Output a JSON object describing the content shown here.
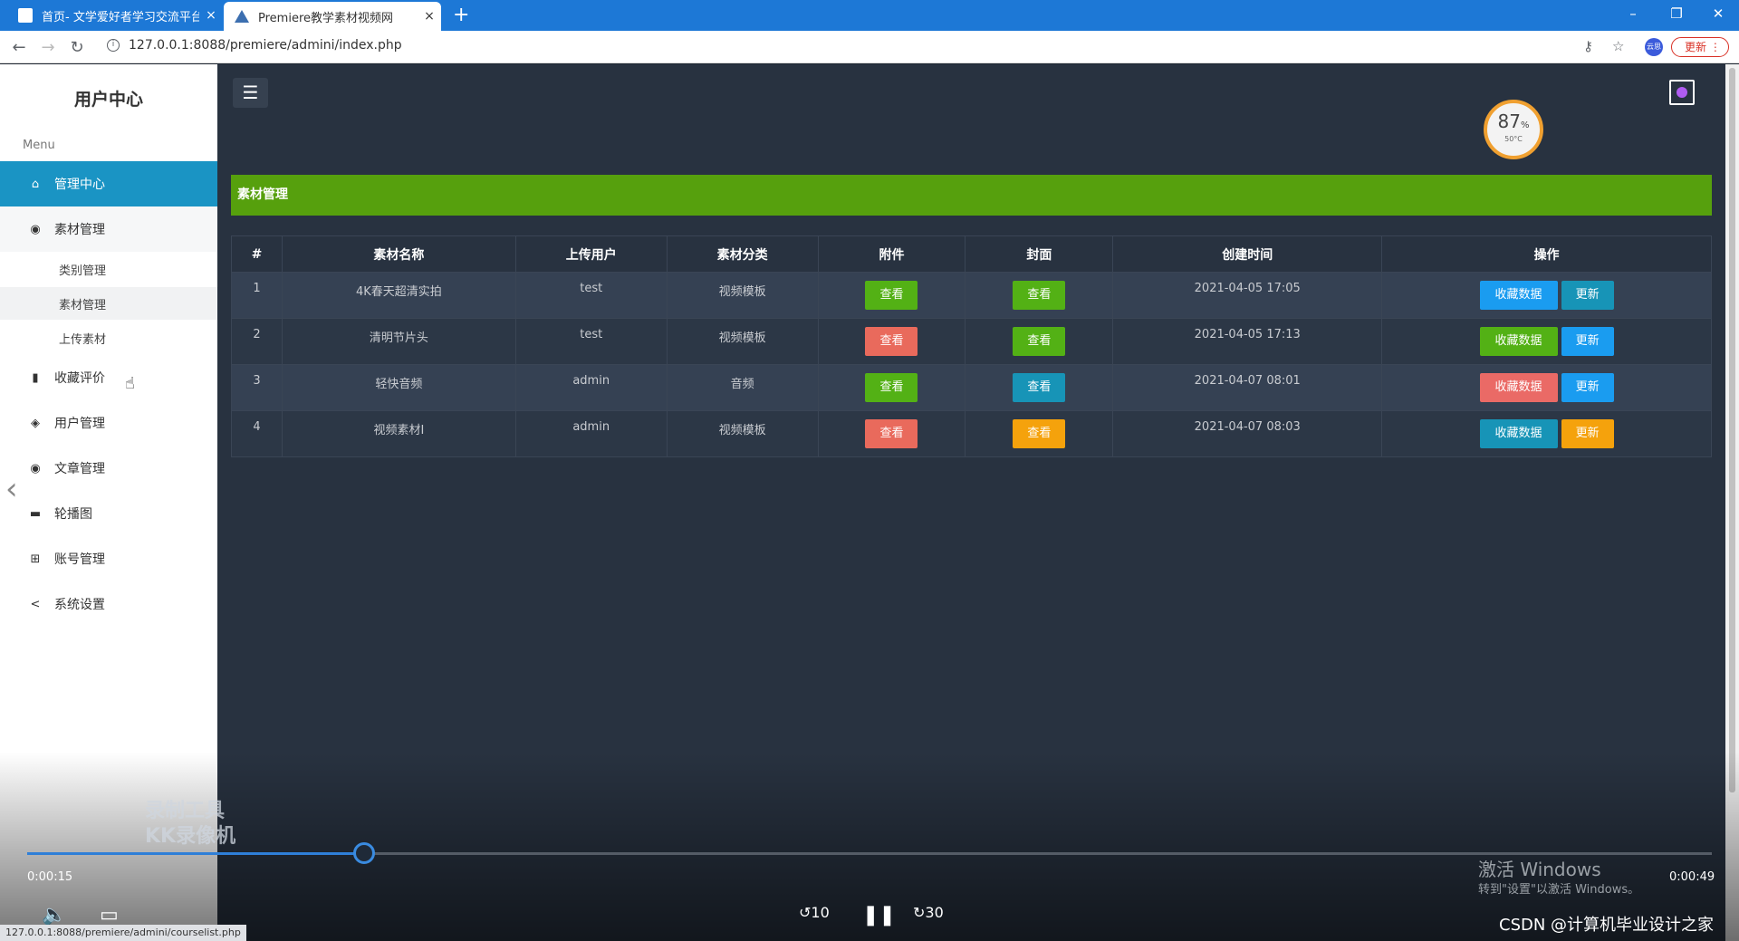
{
  "browser": {
    "tabs": [
      {
        "title": "首页- 文学爱好者学习交流平台",
        "close": "×"
      },
      {
        "title": "Premiere教学素材视频网",
        "close": "×"
      }
    ],
    "new_tab": "+",
    "window": {
      "minimize": "–",
      "restore": "❐",
      "close": "✕"
    },
    "url": "127.0.0.1:8088/premiere/admini/index.php",
    "profile_label": "云思",
    "update_label": "更新",
    "status_url": "127.0.0.1:8088/premiere/admini/courselist.php"
  },
  "sidebar": {
    "title": "用户中心",
    "menu_label": "Menu",
    "items": [
      {
        "label": "管理中心",
        "icon": "home-icon"
      },
      {
        "label": "素材管理",
        "icon": "circle-icon"
      },
      {
        "label": "类别管理",
        "icon": ""
      },
      {
        "label": "素材管理",
        "icon": ""
      },
      {
        "label": "上传素材",
        "icon": ""
      },
      {
        "label": "收藏评价",
        "icon": "book-icon"
      },
      {
        "label": "用户管理",
        "icon": "layers-icon"
      },
      {
        "label": "文章管理",
        "icon": "circle-icon"
      },
      {
        "label": "轮播图",
        "icon": "video-icon"
      },
      {
        "label": "账号管理",
        "icon": "plus-square-icon"
      },
      {
        "label": "系统设置",
        "icon": "share-icon"
      }
    ]
  },
  "widget": {
    "percent": "87",
    "percent_unit": "%",
    "temp": "50°C"
  },
  "section_title": "素材管理",
  "table": {
    "headers": [
      "#",
      "素材名称",
      "上传用户",
      "素材分类",
      "附件",
      "封面",
      "创建时间",
      "操作"
    ],
    "rows": [
      {
        "no": "1",
        "name": "4K春天超清实拍",
        "user": "test",
        "category": "视频模板",
        "attach": "查看",
        "cover": "查看",
        "time": "2021-04-05 17:05",
        "fav": "收藏数据",
        "update": "更新"
      },
      {
        "no": "2",
        "name": "清明节片头",
        "user": "test",
        "category": "视频模板",
        "attach": "查看",
        "cover": "查看",
        "time": "2021-04-05 17:13",
        "fav": "收藏数据",
        "update": "更新"
      },
      {
        "no": "3",
        "name": "轻快音频",
        "user": "admin",
        "category": "音频",
        "attach": "查看",
        "cover": "查看",
        "time": "2021-04-07 08:01",
        "fav": "收藏数据",
        "update": "更新"
      },
      {
        "no": "4",
        "name": "视频素材I",
        "user": "admin",
        "category": "视频模板",
        "attach": "查看",
        "cover": "查看",
        "time": "2021-04-07 08:03",
        "fav": "收藏数据",
        "update": "更新"
      }
    ]
  },
  "player": {
    "elapsed": "0:00:15",
    "total": "0:00:49",
    "progress": 0.2,
    "back_label": "10",
    "fwd_label": "30"
  },
  "watermark": {
    "line1": "录制工具",
    "line2": "KK录像机"
  },
  "windows_activation": {
    "title": "激活 Windows",
    "subtitle": "转到\"设置\"以激活 Windows。"
  },
  "credit": "CSDN @计算机毕业设计之家"
}
